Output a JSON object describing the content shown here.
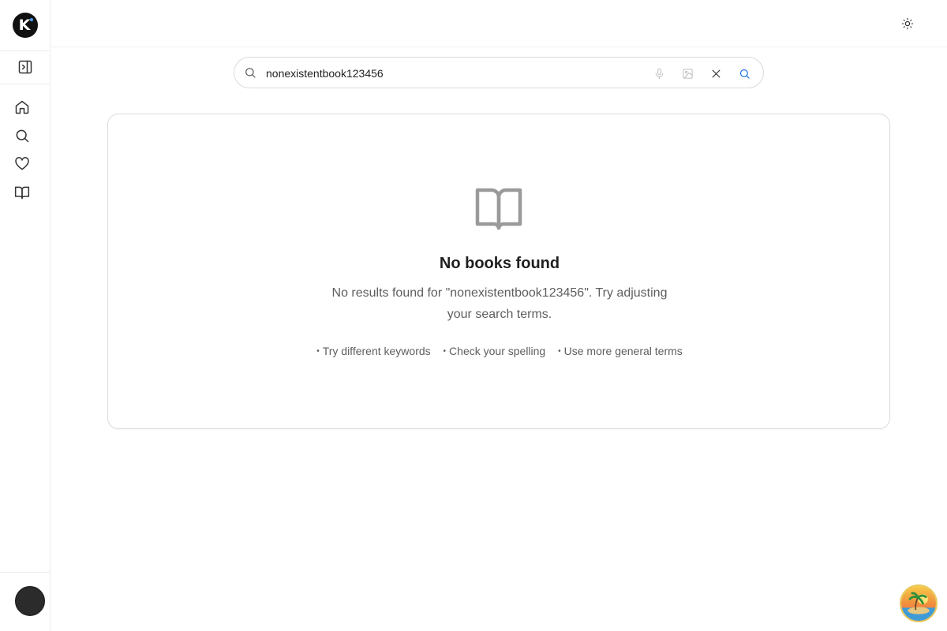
{
  "sidebar": {
    "logo": {
      "letter": "K",
      "icon": "brand-logo-icon"
    },
    "items": [
      {
        "name": "toggle-sidebar",
        "icon": "panel-expand-icon"
      },
      {
        "name": "home",
        "icon": "home-icon"
      },
      {
        "name": "search",
        "icon": "search-icon"
      },
      {
        "name": "favorites",
        "icon": "heart-icon"
      },
      {
        "name": "library",
        "icon": "book-open-icon"
      }
    ],
    "avatar": {
      "icon": "user-avatar"
    }
  },
  "header": {
    "theme_toggle": {
      "icon": "sun-icon"
    }
  },
  "search": {
    "value": "nonexistentbook123456",
    "icons": [
      "search-icon",
      "microphone-icon",
      "image-icon",
      "close-icon",
      "search-submit-icon"
    ],
    "accent": "#1a73e8"
  },
  "empty_state": {
    "icon": "book-open-icon",
    "title": "No books found",
    "message": "No results found for \"nonexistentbook123456\". Try adjusting your search terms.",
    "tips": [
      "Try different keywords",
      "Check your spelling",
      "Use more general terms"
    ]
  },
  "floating_badge": {
    "icon": "island-sunset-icon"
  }
}
